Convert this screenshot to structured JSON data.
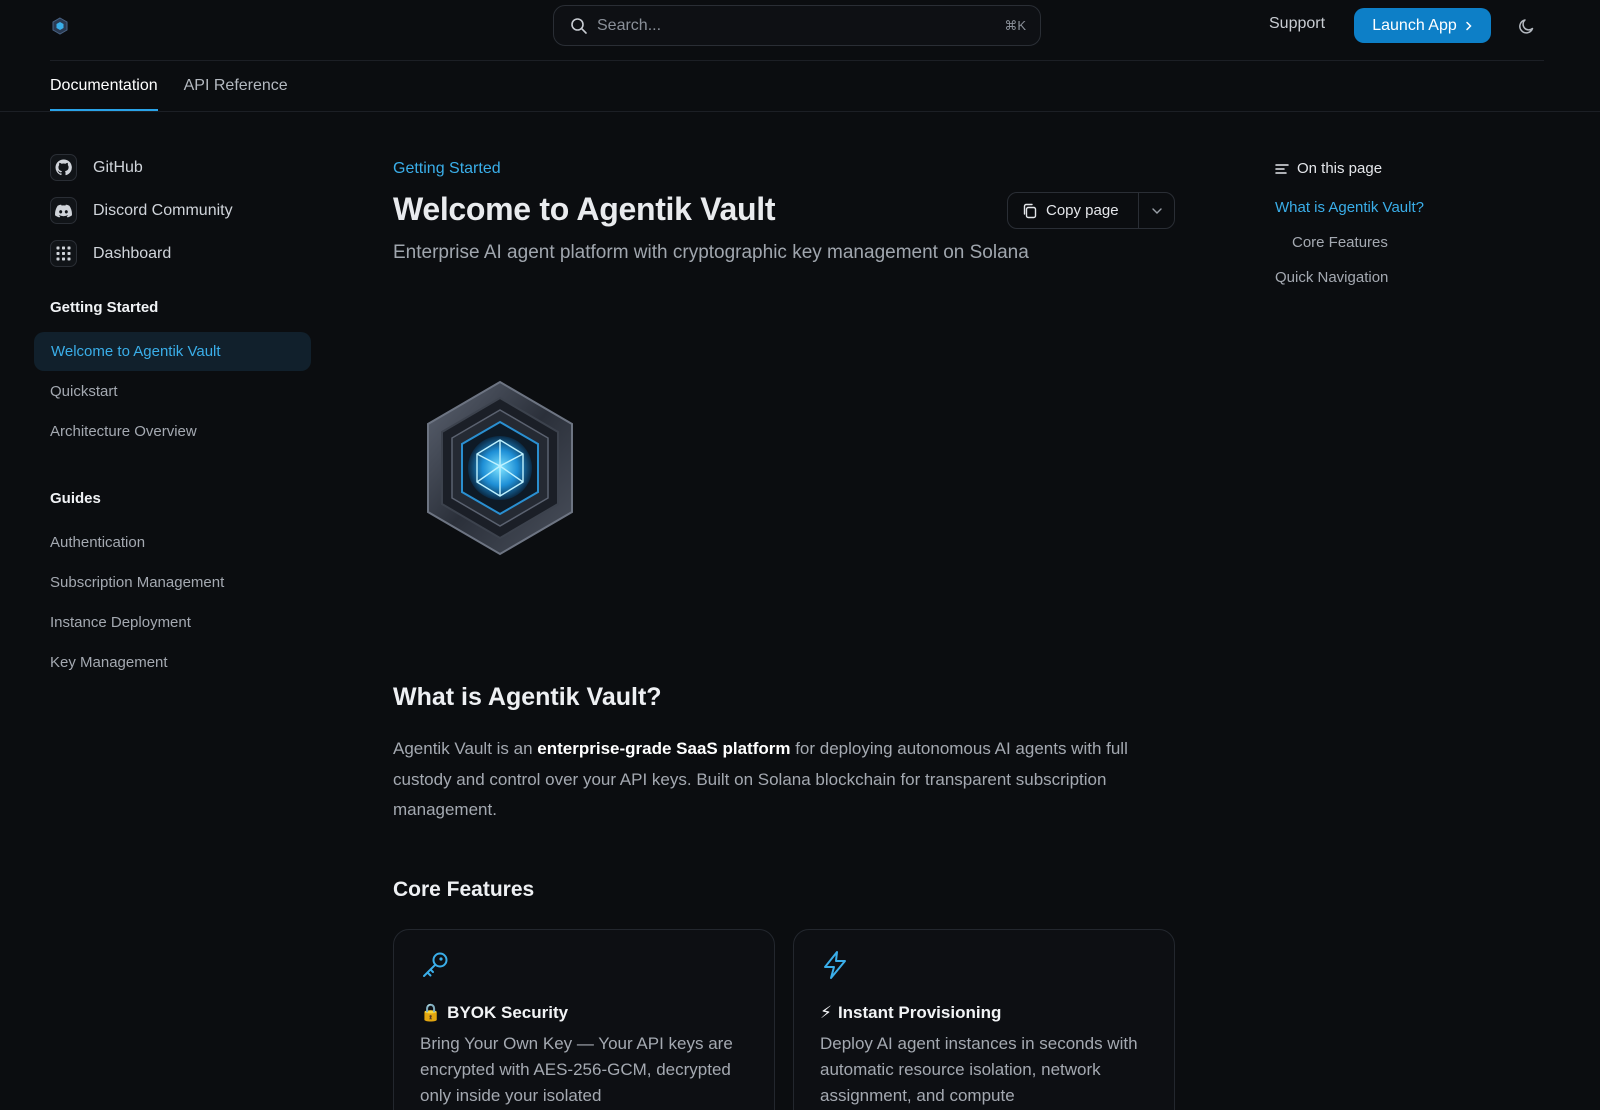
{
  "header": {
    "search_placeholder": "Search...",
    "search_shortcut": "⌘K",
    "support_label": "Support",
    "launch_label": "Launch App"
  },
  "tabs": [
    {
      "label": "Documentation",
      "active": true
    },
    {
      "label": "API Reference",
      "active": false
    }
  ],
  "sidebar": {
    "links": [
      {
        "label": "GitHub",
        "icon": "github-icon"
      },
      {
        "label": "Discord Community",
        "icon": "discord-icon"
      },
      {
        "label": "Dashboard",
        "icon": "grid-icon"
      }
    ],
    "groups": [
      {
        "title": "Getting Started",
        "items": [
          "Welcome to Agentik Vault",
          "Quickstart",
          "Architecture Overview"
        ],
        "active_item": "Welcome to Agentik Vault"
      },
      {
        "title": "Guides",
        "items": [
          "Authentication",
          "Subscription Management",
          "Instance Deployment",
          "Key Management"
        ]
      }
    ]
  },
  "main": {
    "eyebrow": "Getting Started",
    "title": "Welcome to Agentik Vault",
    "copy_label": "Copy page",
    "subtitle": "Enterprise AI agent platform with cryptographic key management on Solana",
    "section_what": "What is Agentik Vault?",
    "para_lead": "Agentik Vault is an ",
    "para_bold": "enterprise-grade SaaS platform",
    "para_rest": " for deploying autonomous AI agents with full custody and control over your API keys. Built on Solana blockchain for transparent subscription management.",
    "section_features": "Core Features",
    "cards": [
      {
        "emoji": "🔒",
        "title": "BYOK Security",
        "desc": "Bring Your Own Key — Your API keys are encrypted with AES-256-GCM, decrypted only inside your isolated",
        "icon": "key-icon"
      },
      {
        "emoji": "⚡",
        "title": "Instant Provisioning",
        "desc": "Deploy AI agent instances in seconds with automatic resource isolation, network assignment, and compute",
        "icon": "lightning-icon"
      }
    ]
  },
  "toc": {
    "heading": "On this page",
    "items": [
      {
        "label": "What is Agentik Vault?",
        "active": true
      },
      {
        "label": "Core Features",
        "active": false
      },
      {
        "label": "Quick Navigation",
        "active": false
      }
    ]
  },
  "colors": {
    "accent": "#2aa3e8",
    "primary_button": "#0d7fc7",
    "background": "#0b0d10"
  }
}
